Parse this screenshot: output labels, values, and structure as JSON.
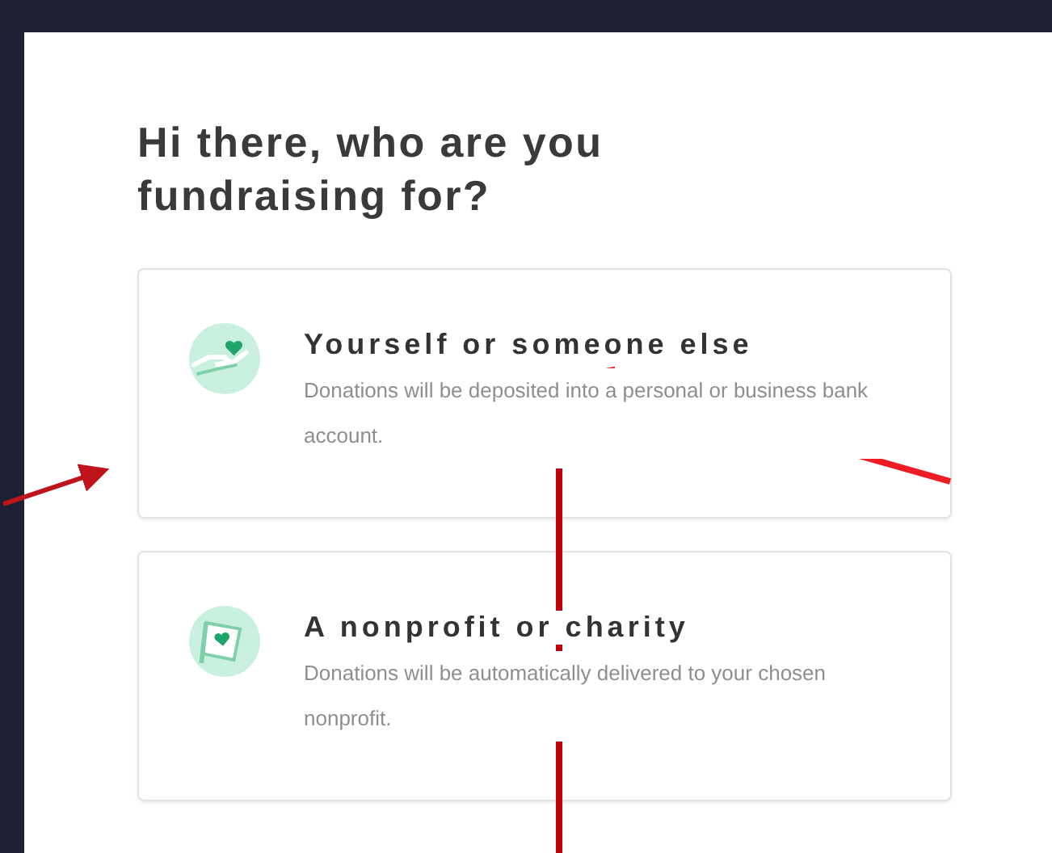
{
  "heading": "Hi there, who are you fundraising for?",
  "options": [
    {
      "kind": "personal",
      "title": "Yourself or someone else",
      "description": "Donations will be deposited into a personal or business bank account."
    },
    {
      "kind": "charity",
      "title": "A nonprofit or charity",
      "description": "Donations will be automatically delivered to your chosen nonprofit."
    }
  ]
}
